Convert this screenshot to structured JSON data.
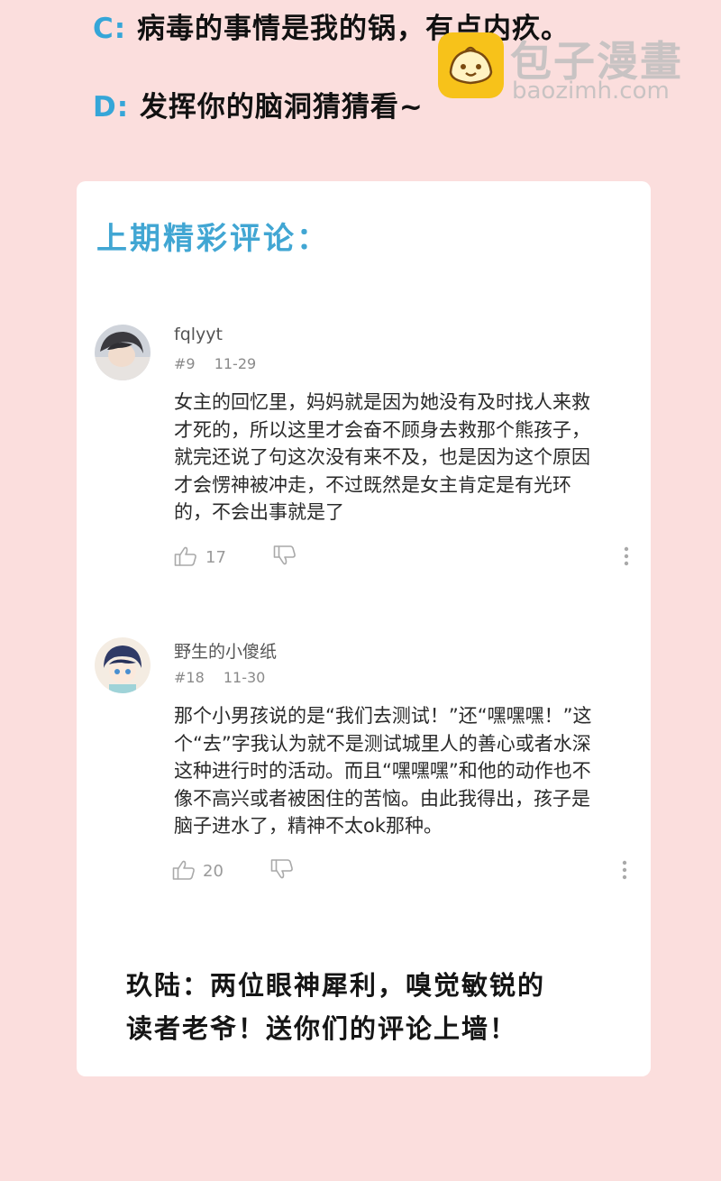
{
  "quiz": {
    "option_c_letter": "C:",
    "option_c_text": "病毒的事情是我的锅，有点内疚。",
    "option_d_letter": "D:",
    "option_d_text": "发挥你的脑洞猜猜看~"
  },
  "watermark": {
    "title": "包子漫畫",
    "url": "baozimh.com",
    "logo_icon": "bun-icon"
  },
  "card": {
    "heading": "上期精彩评论：",
    "comments": [
      {
        "username": "fqlyyt",
        "floor": "#9",
        "date": "11-29",
        "lines": [
          "女主的回忆里，妈妈就是因为她没有及时找人来救",
          "才死的，所以这里才会奋不顾身去救那个熊孩子，",
          "就完还说了句这次没有来不及，也是因为这个原因",
          "才会愣神被冲走，不过既然是女主肯定是有光环",
          "的，不会出事就是了"
        ],
        "likes": "17"
      },
      {
        "username": "野生的小傻纸",
        "floor": "#18",
        "date": "11-30",
        "lines": [
          "那个小男孩说的是“我们去测试！”还“嘿嘿嘿！”这",
          "个“去”字我认为就不是测试城里人的善心或者水深",
          "这种进行时的活动。而且“嘿嘿嘿”和他的动作也不",
          "像不高兴或者被困住的苦恼。由此我得出，孩子是",
          "脑子进水了，精神不太ok那种。"
        ],
        "likes": "20"
      }
    ],
    "closing_lines": [
      "玖陆：两位眼神犀利，嗅觉敏锐的",
      "读者老爷！送你们的评论上墙！"
    ]
  },
  "colors": {
    "background": "#fbdedd",
    "accent_blue": "#41a6d3",
    "card": "#ffffff"
  }
}
